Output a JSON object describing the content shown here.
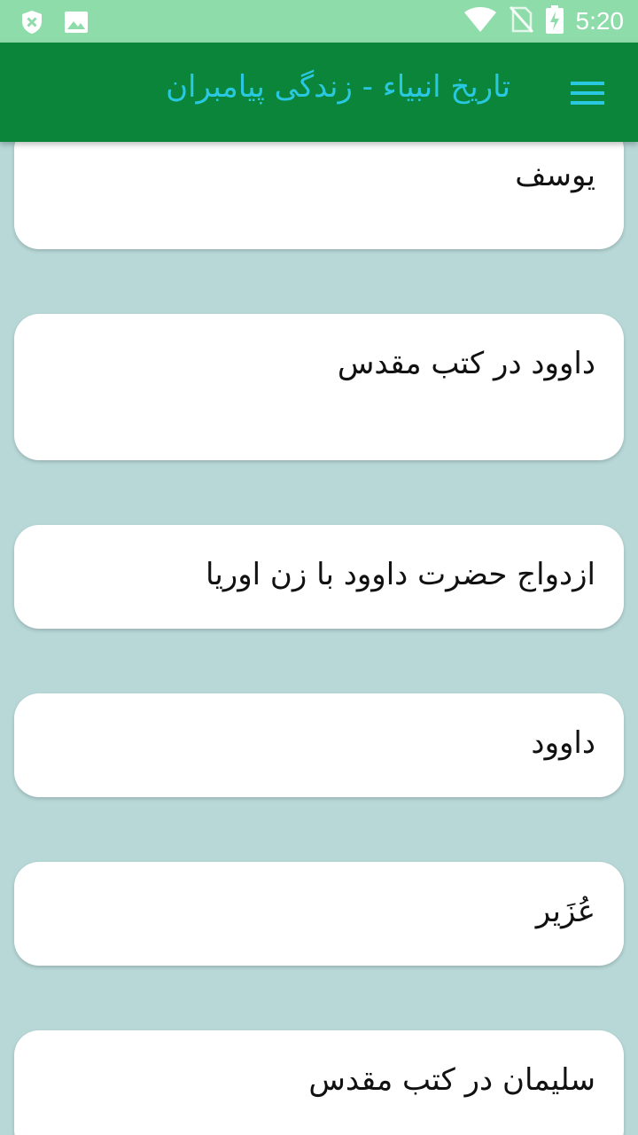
{
  "status_bar": {
    "time": "5:20",
    "icons": [
      "shield-icon",
      "image-icon",
      "wifi-icon",
      "no-sim-icon",
      "battery-charging-icon"
    ]
  },
  "app_bar": {
    "title": "تاریخ انبیاء - زندگی پیامبران",
    "menu_icon": "hamburger-menu-icon"
  },
  "items": [
    {
      "label": "یوسف"
    },
    {
      "label": "داوود در کتب مقدس"
    },
    {
      "label": "ازدواج حضرت داوود با زن اوریا"
    },
    {
      "label": "داوود"
    },
    {
      "label": "عُزَیر"
    },
    {
      "label": "سلیمان در کتب مقدس"
    }
  ],
  "colors": {
    "status_bar": "#8fdcab",
    "app_bar": "#0b853a",
    "title": "#2ac8e0",
    "background": "#b8d8d8",
    "card": "#ffffff"
  }
}
